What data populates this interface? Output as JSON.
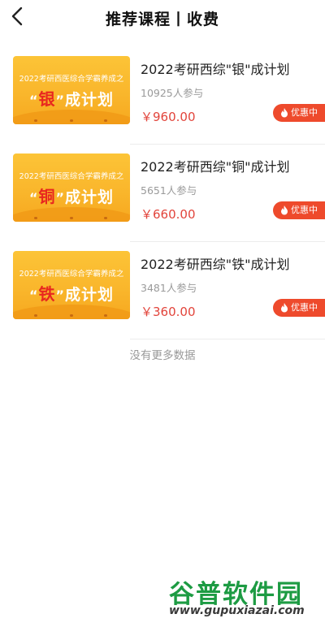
{
  "header": {
    "title": "推荐课程丨收费"
  },
  "courses": [
    {
      "thumb_subtitle": "2022考研西医综合学霸养成之",
      "thumb_left_quote": "“",
      "thumb_highlight": "银",
      "thumb_right_quote": "”",
      "thumb_suffix": "成计划",
      "title": "2022考研西综\"银\"成计划",
      "participants": "10925人参与",
      "price": "￥960.00",
      "badge": "优惠中"
    },
    {
      "thumb_subtitle": "2022考研西医综合学霸养成之",
      "thumb_left_quote": "“",
      "thumb_highlight": "铜",
      "thumb_right_quote": "”",
      "thumb_suffix": "成计划",
      "title": "2022考研西综\"铜\"成计划",
      "participants": "5651人参与",
      "price": "￥660.00",
      "badge": "优惠中"
    },
    {
      "thumb_subtitle": "2022考研西医综合学霸养成之",
      "thumb_left_quote": "“",
      "thumb_highlight": "铁",
      "thumb_right_quote": "”",
      "thumb_suffix": "成计划",
      "title": "2022考研西综\"铁\"成计划",
      "participants": "3481人参与",
      "price": "￥360.00",
      "badge": "优惠中"
    }
  ],
  "footer": {
    "no_more": "没有更多数据"
  },
  "watermark": {
    "brand": "谷普软件园",
    "url": "www.gupuxiazai.com"
  },
  "colors": {
    "price": "#e2443b",
    "badge_bg": "#ee4a2c",
    "thumb_yellow": "#f9b52b",
    "highlight": "#e8271f",
    "watermark_green": "#1d9b43"
  },
  "icons": {
    "back": "chevron-left-icon",
    "fire": "fire-icon"
  }
}
